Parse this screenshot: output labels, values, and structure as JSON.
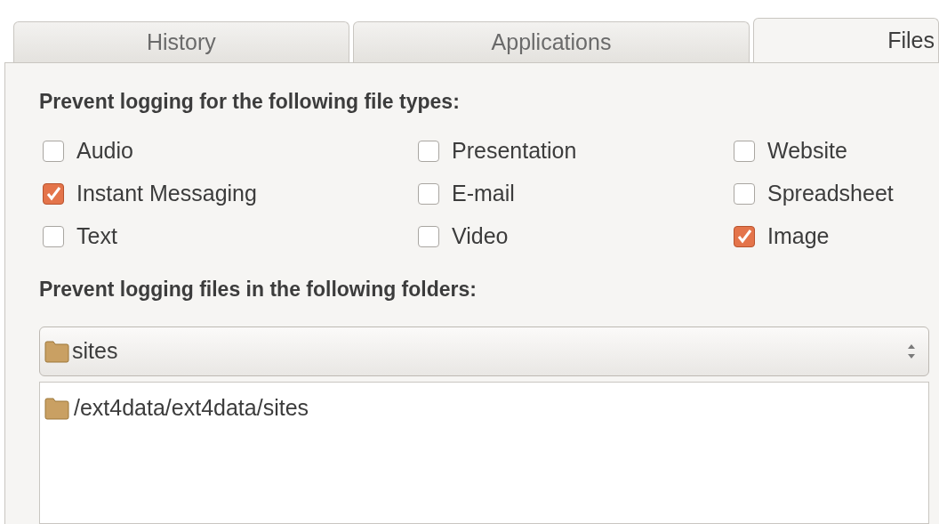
{
  "tabs": [
    {
      "label": "History",
      "selected": false
    },
    {
      "label": "Applications",
      "selected": false
    },
    {
      "label": "Files",
      "selected": true
    }
  ],
  "file_types": {
    "heading": "Prevent logging for the following file types:",
    "options": [
      {
        "label": "Audio",
        "checked": false
      },
      {
        "label": "Presentation",
        "checked": false
      },
      {
        "label": "Website",
        "checked": false
      },
      {
        "label": "Instant Messaging",
        "checked": true
      },
      {
        "label": "E-mail",
        "checked": false
      },
      {
        "label": "Spreadsheet",
        "checked": false
      },
      {
        "label": "Text",
        "checked": false
      },
      {
        "label": "Video",
        "checked": false
      },
      {
        "label": "Image",
        "checked": true
      }
    ]
  },
  "folders": {
    "heading": "Prevent logging files in the following folders:",
    "chooser": {
      "value": "sites"
    },
    "list": [
      {
        "path": "/ext4data/ext4data/sites"
      }
    ]
  }
}
